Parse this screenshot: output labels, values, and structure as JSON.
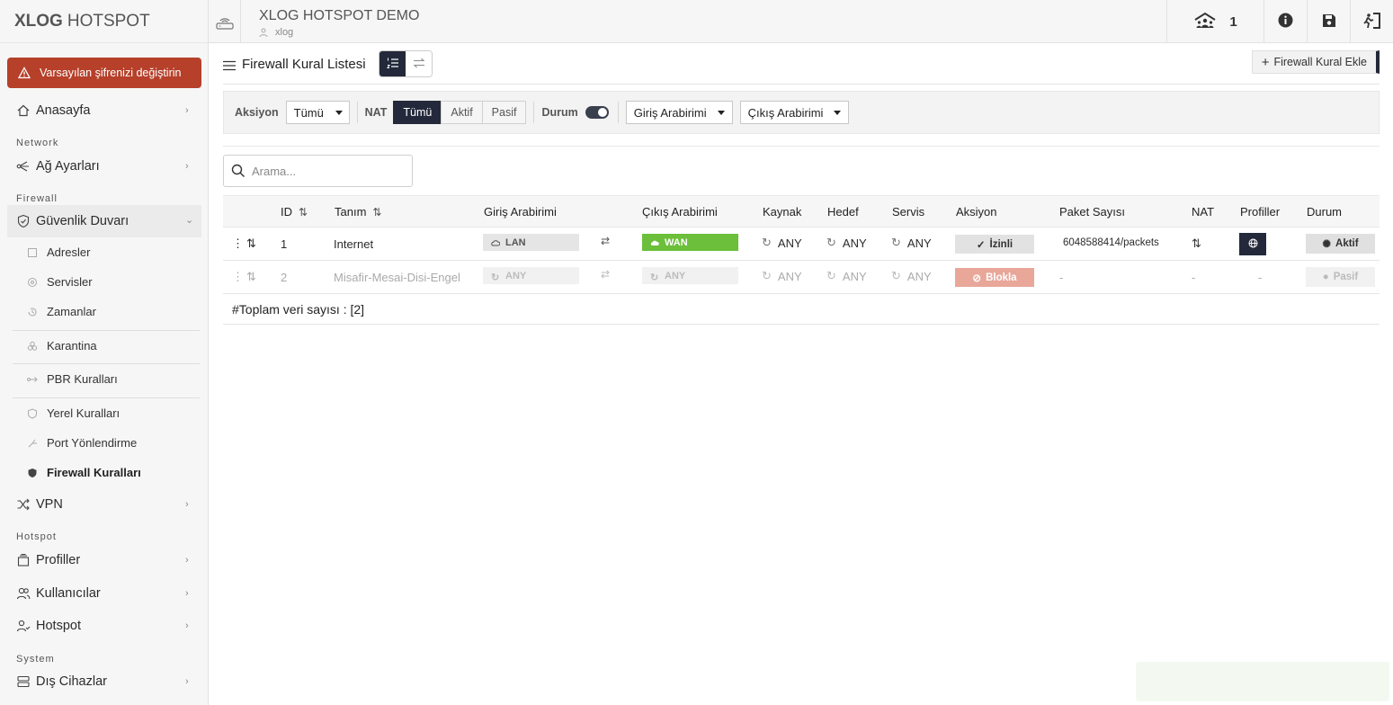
{
  "brand": {
    "bold": "XLOG",
    "light": "HOTSPOT"
  },
  "warning_button": "Varsayılan şifrenizi değiştirin",
  "sidebar": {
    "home": "Anasayfa",
    "section_network": "Network",
    "network_settings": "Ağ Ayarları",
    "section_firewall": "Firewall",
    "firewall": "Güvenlik Duvarı",
    "sub_items": [
      "Adresler",
      "Servisler",
      "Zamanlar",
      "Karantina",
      "PBR Kuralları",
      "Yerel Kuralları",
      "Port Yönlendirme",
      "Firewall Kuralları"
    ],
    "vpn": "VPN",
    "section_hotspot": "Hotspot",
    "profiles": "Profiller",
    "users": "Kullanıcılar",
    "hotspot": "Hotspot",
    "section_system": "System",
    "external_devices": "Dış Cihazlar"
  },
  "header": {
    "site_title": "XLOG HOTSPOT DEMO",
    "site_user": "xlog",
    "online_count": "1"
  },
  "page": {
    "title": "Firewall Kural Listesi",
    "add_button": "Firewall Kural Ekle"
  },
  "filters": {
    "action_label": "Aksiyon",
    "action_value": "Tümü",
    "nat_label": "NAT",
    "nat_options": [
      "Tümü",
      "Aktif",
      "Pasif"
    ],
    "nat_selected": "Tümü",
    "status_label": "Durum",
    "status_on": true,
    "in_iface": "Giriş Arabirimi",
    "out_iface": "Çıkış Arabirimi"
  },
  "search": {
    "placeholder": "Arama..."
  },
  "table": {
    "columns": [
      "ID",
      "Tanım",
      "Giriş Arabirimi",
      "Çıkış Arabirimi",
      "Kaynak",
      "Hedef",
      "Servis",
      "Aksiyon",
      "Paket Sayısı",
      "NAT",
      "Profiller",
      "Durum"
    ],
    "rows": [
      {
        "id": "1",
        "name": "Internet",
        "in": "LAN",
        "out": "WAN",
        "src": "ANY",
        "dst": "ANY",
        "svc": "ANY",
        "action": "İzinli",
        "packets": "6048588414/packets",
        "nat": "",
        "profile": "",
        "status": "Aktif"
      },
      {
        "id": "2",
        "name": "Misafir-Mesai-Disi-Engel",
        "in": "ANY",
        "out": "ANY",
        "src": "ANY",
        "dst": "ANY",
        "svc": "ANY",
        "action": "Blokla",
        "packets": "-",
        "nat": "-",
        "profile": "-",
        "status": "Pasif"
      }
    ],
    "total_text": "#Toplam veri sayısı : [2]"
  },
  "colors": {
    "accent": "#23293a",
    "warning": "#b6402a",
    "wan": "#6bbf3a",
    "block": "#e8a799"
  }
}
